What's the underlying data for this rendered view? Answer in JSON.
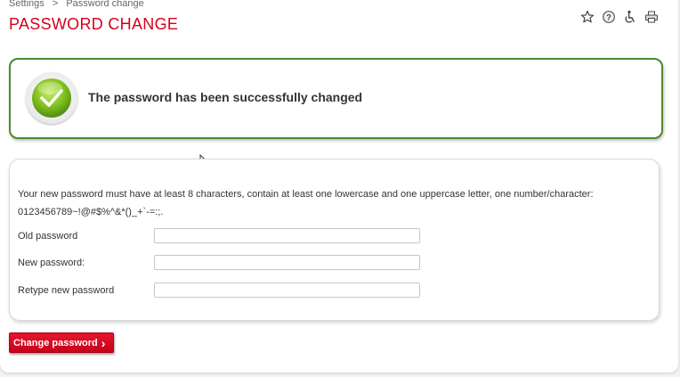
{
  "breadcrumb": {
    "root": "Settings",
    "separator": ">",
    "current": "Password change"
  },
  "page_title": "PASSWORD CHANGE",
  "toolbar": {
    "icons": [
      "star-icon",
      "help-icon",
      "accessibility-icon",
      "print-icon"
    ]
  },
  "success": {
    "message": "The password has been successfully changed",
    "border_color": "#4e8a2e",
    "icon_color": "#7fbf1f"
  },
  "form": {
    "rules_line1": "Your new password must have at least 8 characters, contain at least one lowercase and one uppercase letter, one number/character:",
    "rules_line2": "0123456789~!@#$%^&*()_+`-=:;.",
    "fields": [
      {
        "label": "Old password",
        "value": ""
      },
      {
        "label": "New password:",
        "value": ""
      },
      {
        "label": "Retype new password",
        "value": ""
      }
    ]
  },
  "submit": {
    "label": "Change password",
    "arrow": "›"
  },
  "colors": {
    "accent": "#d6001c",
    "button": "#d40a22"
  }
}
